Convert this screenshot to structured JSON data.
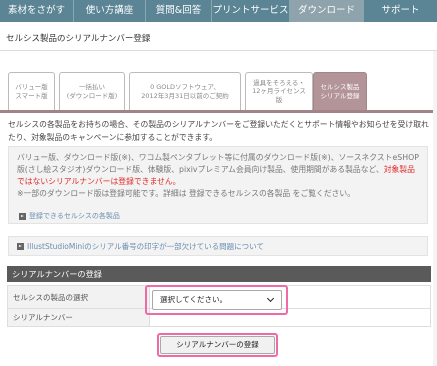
{
  "nav": [
    {
      "label": "素材をさがす"
    },
    {
      "label": "使い方講座"
    },
    {
      "label": "質問&回答"
    },
    {
      "label": "プリントサービス"
    },
    {
      "label": "ダウンロード"
    },
    {
      "label": "サポート"
    }
  ],
  "page": {
    "title": "セルシス製品のシリアルナンバー登録"
  },
  "tabs": [
    {
      "label": "バリュー版\nスマート版"
    },
    {
      "label": "一括払い\n(ダウンロード版)"
    },
    {
      "label": "0 GOLDソフトウェア、\n2012年3月31日以前のご契約"
    },
    {
      "label": "過具をそろえる・\n12ヶ月ライセンス版"
    },
    {
      "label": "セルシス製品\nシリアル登録"
    }
  ],
  "intro": "セルシスの各製品をお持ちの場合、その製品のシリアルナンバーをご登録いただくとサポート情報やお知らせを受け取れたり、対象製品のキャンペーンに参加することができます。",
  "notice": {
    "line1": "バリュー版、ダウンロード版(※)、ワコム製ペンタブレット等に付属のダウンロード版(※)、ソースネクストeSHOP版(さし絵スタジオ)ダウンロード版、体験版、pixivプレミアム会員向け製品、使用期間がある製品など、",
    "red": "対象製品ではないシリアルナンバーは登録できません。",
    "line2": "※一部のダウンロード版は登録可能です。詳細は 登録できるセルシスの各製品 をご覧ください。",
    "link": "登録できるセルシスの各製品"
  },
  "trouble_link": "IllustStudioMiniのシリアル番号の印字が一部欠けている問題について",
  "section": {
    "title": "シリアルナンバーの登録",
    "product_label": "セルシスの製品の選択",
    "select_value": "選択してください。",
    "serial_label": "シリアルナンバー",
    "submit": "シリアルナンバーの登録"
  }
}
